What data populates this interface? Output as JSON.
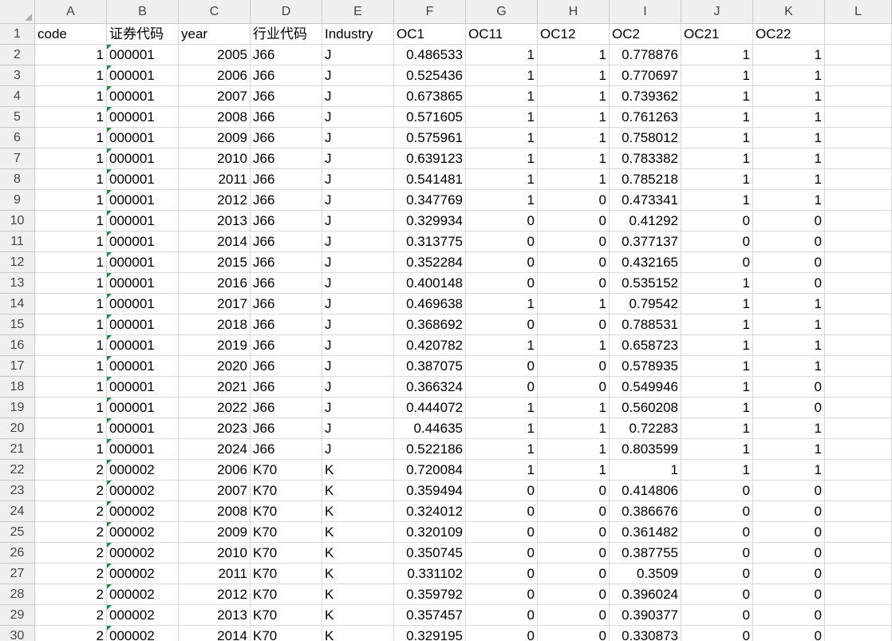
{
  "sheet": {
    "columns": [
      "A",
      "B",
      "C",
      "D",
      "E",
      "F",
      "G",
      "H",
      "I",
      "J",
      "K",
      "L"
    ],
    "header_row": [
      "code",
      "证券代码",
      "year",
      "行业代码",
      "Industry",
      "OC1",
      "OC11",
      "OC12",
      "OC2",
      "OC21",
      "OC22",
      ""
    ],
    "rows": [
      [
        "1",
        "000001",
        "2005",
        "J66",
        "J",
        "0.486533",
        "1",
        "1",
        "0.778876",
        "1",
        "1"
      ],
      [
        "1",
        "000001",
        "2006",
        "J66",
        "J",
        "0.525436",
        "1",
        "1",
        "0.770697",
        "1",
        "1"
      ],
      [
        "1",
        "000001",
        "2007",
        "J66",
        "J",
        "0.673865",
        "1",
        "1",
        "0.739362",
        "1",
        "1"
      ],
      [
        "1",
        "000001",
        "2008",
        "J66",
        "J",
        "0.571605",
        "1",
        "1",
        "0.761263",
        "1",
        "1"
      ],
      [
        "1",
        "000001",
        "2009",
        "J66",
        "J",
        "0.575961",
        "1",
        "1",
        "0.758012",
        "1",
        "1"
      ],
      [
        "1",
        "000001",
        "2010",
        "J66",
        "J",
        "0.639123",
        "1",
        "1",
        "0.783382",
        "1",
        "1"
      ],
      [
        "1",
        "000001",
        "2011",
        "J66",
        "J",
        "0.541481",
        "1",
        "1",
        "0.785218",
        "1",
        "1"
      ],
      [
        "1",
        "000001",
        "2012",
        "J66",
        "J",
        "0.347769",
        "1",
        "0",
        "0.473341",
        "1",
        "1"
      ],
      [
        "1",
        "000001",
        "2013",
        "J66",
        "J",
        "0.329934",
        "0",
        "0",
        "0.41292",
        "0",
        "0"
      ],
      [
        "1",
        "000001",
        "2014",
        "J66",
        "J",
        "0.313775",
        "0",
        "0",
        "0.377137",
        "0",
        "0"
      ],
      [
        "1",
        "000001",
        "2015",
        "J66",
        "J",
        "0.352284",
        "0",
        "0",
        "0.432165",
        "0",
        "0"
      ],
      [
        "1",
        "000001",
        "2016",
        "J66",
        "J",
        "0.400148",
        "0",
        "0",
        "0.535152",
        "1",
        "0"
      ],
      [
        "1",
        "000001",
        "2017",
        "J66",
        "J",
        "0.469638",
        "1",
        "1",
        "0.79542",
        "1",
        "1"
      ],
      [
        "1",
        "000001",
        "2018",
        "J66",
        "J",
        "0.368692",
        "0",
        "0",
        "0.788531",
        "1",
        "1"
      ],
      [
        "1",
        "000001",
        "2019",
        "J66",
        "J",
        "0.420782",
        "1",
        "1",
        "0.658723",
        "1",
        "1"
      ],
      [
        "1",
        "000001",
        "2020",
        "J66",
        "J",
        "0.387075",
        "0",
        "0",
        "0.578935",
        "1",
        "1"
      ],
      [
        "1",
        "000001",
        "2021",
        "J66",
        "J",
        "0.366324",
        "0",
        "0",
        "0.549946",
        "1",
        "0"
      ],
      [
        "1",
        "000001",
        "2022",
        "J66",
        "J",
        "0.444072",
        "1",
        "1",
        "0.560208",
        "1",
        "0"
      ],
      [
        "1",
        "000001",
        "2023",
        "J66",
        "J",
        "0.44635",
        "1",
        "1",
        "0.72283",
        "1",
        "1"
      ],
      [
        "1",
        "000001",
        "2024",
        "J66",
        "J",
        "0.522186",
        "1",
        "1",
        "0.803599",
        "1",
        "1"
      ],
      [
        "2",
        "000002",
        "2006",
        "K70",
        "K",
        "0.720084",
        "1",
        "1",
        "1",
        "1",
        "1"
      ],
      [
        "2",
        "000002",
        "2007",
        "K70",
        "K",
        "0.359494",
        "0",
        "0",
        "0.414806",
        "0",
        "0"
      ],
      [
        "2",
        "000002",
        "2008",
        "K70",
        "K",
        "0.324012",
        "0",
        "0",
        "0.386676",
        "0",
        "0"
      ],
      [
        "2",
        "000002",
        "2009",
        "K70",
        "K",
        "0.320109",
        "0",
        "0",
        "0.361482",
        "0",
        "0"
      ],
      [
        "2",
        "000002",
        "2010",
        "K70",
        "K",
        "0.350745",
        "0",
        "0",
        "0.387755",
        "0",
        "0"
      ],
      [
        "2",
        "000002",
        "2011",
        "K70",
        "K",
        "0.331102",
        "0",
        "0",
        "0.3509",
        "0",
        "0"
      ],
      [
        "2",
        "000002",
        "2012",
        "K70",
        "K",
        "0.359792",
        "0",
        "0",
        "0.396024",
        "0",
        "0"
      ],
      [
        "2",
        "000002",
        "2013",
        "K70",
        "K",
        "0.357457",
        "0",
        "0",
        "0.390377",
        "0",
        "0"
      ],
      [
        "2",
        "000002",
        "2014",
        "K70",
        "K",
        "0.329195",
        "0",
        "0",
        "0.330873",
        "0",
        "0"
      ]
    ]
  }
}
